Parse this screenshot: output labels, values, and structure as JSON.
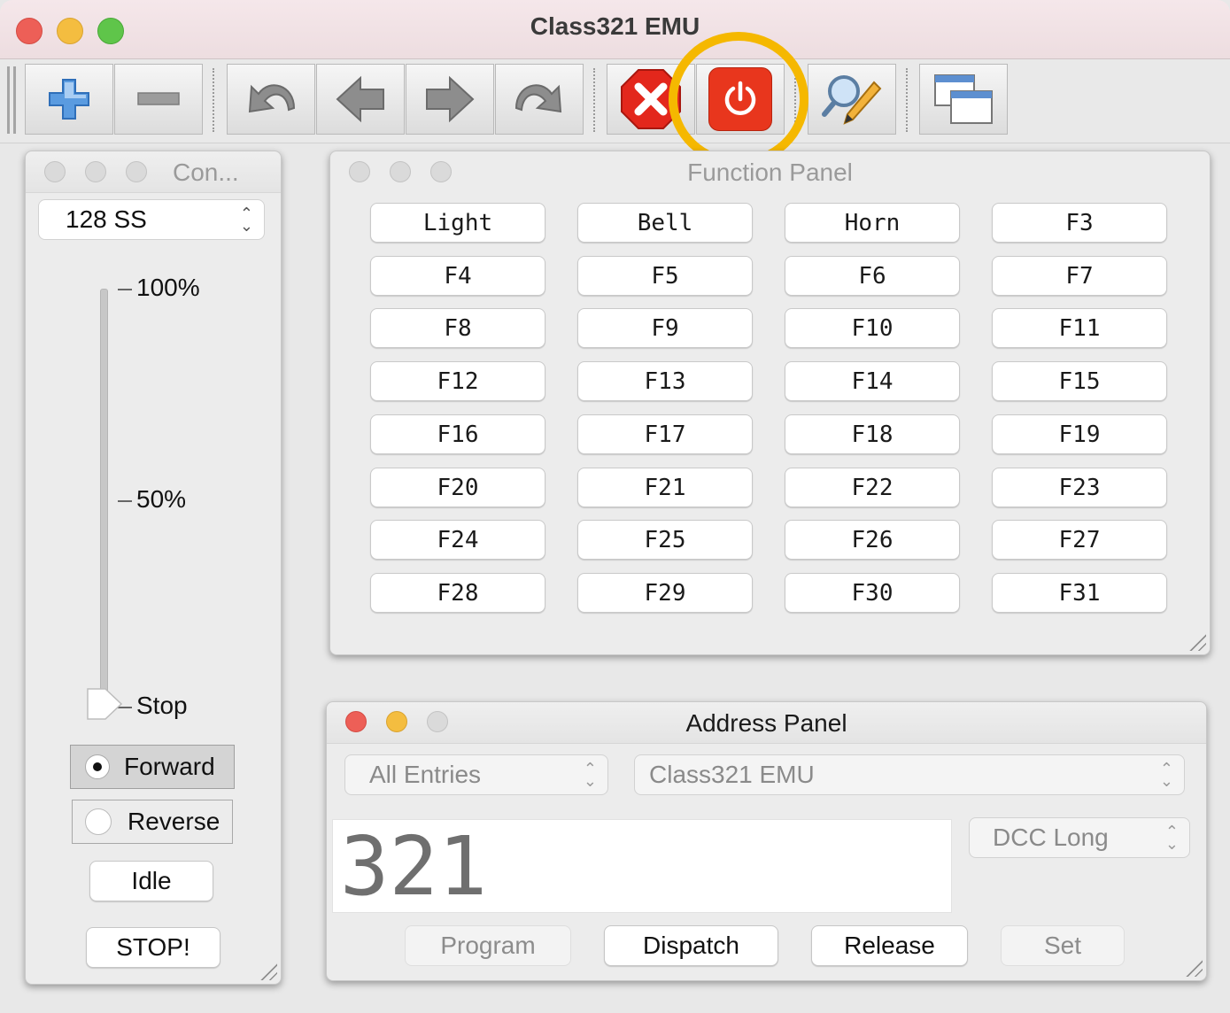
{
  "window": {
    "title": "Class321 EMU"
  },
  "toolbar": {
    "buttons": [
      {
        "icon": "plus-icon"
      },
      {
        "icon": "minus-icon"
      },
      {
        "icon": "undo-icon"
      },
      {
        "icon": "arrow-left-icon"
      },
      {
        "icon": "arrow-right-icon"
      },
      {
        "icon": "redo-icon"
      },
      {
        "icon": "stop-x-icon"
      },
      {
        "icon": "power-icon"
      },
      {
        "icon": "search-edit-icon"
      },
      {
        "icon": "windows-icon"
      }
    ],
    "highlight_color": "#f5b800",
    "power_color": "#e8361d"
  },
  "control_panel": {
    "title": "Con...",
    "speed_steps": "128 SS",
    "slider_labels": [
      "100%",
      "50%",
      "Stop"
    ],
    "slider_value": 0,
    "forward_label": "Forward",
    "reverse_label": "Reverse",
    "direction": "Forward",
    "idle_label": "Idle",
    "stop_label": "STOP!"
  },
  "function_panel": {
    "title": "Function Panel",
    "buttons": [
      "Light",
      "Bell",
      "Horn",
      "F3",
      "F4",
      "F5",
      "F6",
      "F7",
      "F8",
      "F9",
      "F10",
      "F11",
      "F12",
      "F13",
      "F14",
      "F15",
      "F16",
      "F17",
      "F18",
      "F19",
      "F20",
      "F21",
      "F22",
      "F23",
      "F24",
      "F25",
      "F26",
      "F27",
      "F28",
      "F29",
      "F30",
      "F31"
    ]
  },
  "address_panel": {
    "title": "Address Panel",
    "roster_filter": "All Entries",
    "roster_entry": "Class321 EMU",
    "address": "321",
    "protocol": "DCC Long",
    "program_label": "Program",
    "dispatch_label": "Dispatch",
    "release_label": "Release",
    "set_label": "Set"
  }
}
